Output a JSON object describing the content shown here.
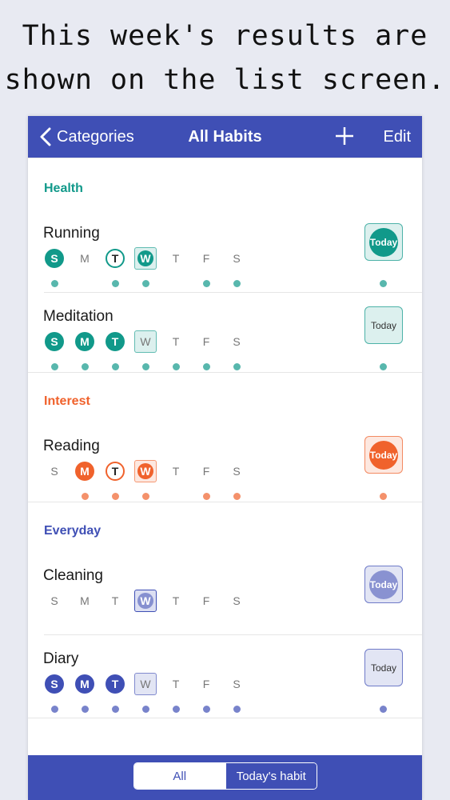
{
  "caption": {
    "line1": "This week's results are",
    "line2": "shown on the list screen."
  },
  "navbar": {
    "back_label": "Categories",
    "title": "All Habits",
    "add_icon": "plus-icon",
    "edit_label": "Edit"
  },
  "colors": {
    "nav": "#3f4fb5",
    "health": "#11998a",
    "interest": "#f0622c",
    "everyday": "#3f4fb5"
  },
  "sections": [
    {
      "title": "Health",
      "color": "#11998a",
      "habits": [
        {
          "name": "Running",
          "days": [
            {
              "label": "S",
              "state": "filled",
              "dot": true
            },
            {
              "label": "M",
              "state": "none",
              "dot": false
            },
            {
              "label": "T",
              "state": "ring",
              "dot": true
            },
            {
              "label": "W",
              "state": "today-filled",
              "dot": true
            },
            {
              "label": "T",
              "state": "none",
              "dot": false
            },
            {
              "label": "F",
              "state": "none",
              "dot": true
            },
            {
              "label": "S",
              "state": "none",
              "dot": true
            }
          ],
          "today_label": "Today",
          "today_done": true,
          "today_dot": true
        },
        {
          "name": "Meditation",
          "days": [
            {
              "label": "S",
              "state": "filled",
              "dot": true
            },
            {
              "label": "M",
              "state": "filled",
              "dot": true
            },
            {
              "label": "T",
              "state": "filled",
              "dot": true
            },
            {
              "label": "W",
              "state": "today-empty",
              "dot": true
            },
            {
              "label": "T",
              "state": "none",
              "dot": true
            },
            {
              "label": "F",
              "state": "none",
              "dot": true
            },
            {
              "label": "S",
              "state": "none",
              "dot": true
            }
          ],
          "today_label": "Today",
          "today_done": false,
          "today_dot": true
        }
      ]
    },
    {
      "title": "Interest",
      "color": "#f0622c",
      "habits": [
        {
          "name": "Reading",
          "days": [
            {
              "label": "S",
              "state": "none",
              "dot": false
            },
            {
              "label": "M",
              "state": "filled",
              "dot": true
            },
            {
              "label": "T",
              "state": "ring",
              "dot": true
            },
            {
              "label": "W",
              "state": "today-filled",
              "dot": true
            },
            {
              "label": "T",
              "state": "none",
              "dot": false
            },
            {
              "label": "F",
              "state": "none",
              "dot": true
            },
            {
              "label": "S",
              "state": "none",
              "dot": true
            }
          ],
          "today_label": "Today",
          "today_done": true,
          "today_dot": true
        }
      ]
    },
    {
      "title": "Everyday",
      "color": "#3f4fb5",
      "habits": [
        {
          "name": "Cleaning",
          "days": [
            {
              "label": "S",
              "state": "none",
              "dot": false
            },
            {
              "label": "M",
              "state": "none",
              "dot": false
            },
            {
              "label": "T",
              "state": "none",
              "dot": false
            },
            {
              "label": "W",
              "state": "today-filled-soft",
              "dot": false
            },
            {
              "label": "T",
              "state": "none",
              "dot": false
            },
            {
              "label": "F",
              "state": "none",
              "dot": false
            },
            {
              "label": "S",
              "state": "none",
              "dot": false
            }
          ],
          "today_label": "Today",
          "today_done": true,
          "today_soft": true,
          "today_dot": false
        },
        {
          "name": "Diary",
          "days": [
            {
              "label": "S",
              "state": "filled",
              "dot": true
            },
            {
              "label": "M",
              "state": "filled",
              "dot": true
            },
            {
              "label": "T",
              "state": "filled",
              "dot": true
            },
            {
              "label": "W",
              "state": "today-empty",
              "dot": true
            },
            {
              "label": "T",
              "state": "none",
              "dot": true
            },
            {
              "label": "F",
              "state": "none",
              "dot": true
            },
            {
              "label": "S",
              "state": "none",
              "dot": true
            }
          ],
          "today_label": "Today",
          "today_done": false,
          "today_dot": true
        }
      ]
    }
  ],
  "tabbar": {
    "all_label": "All",
    "today_label": "Today's habit",
    "selected": "All"
  }
}
